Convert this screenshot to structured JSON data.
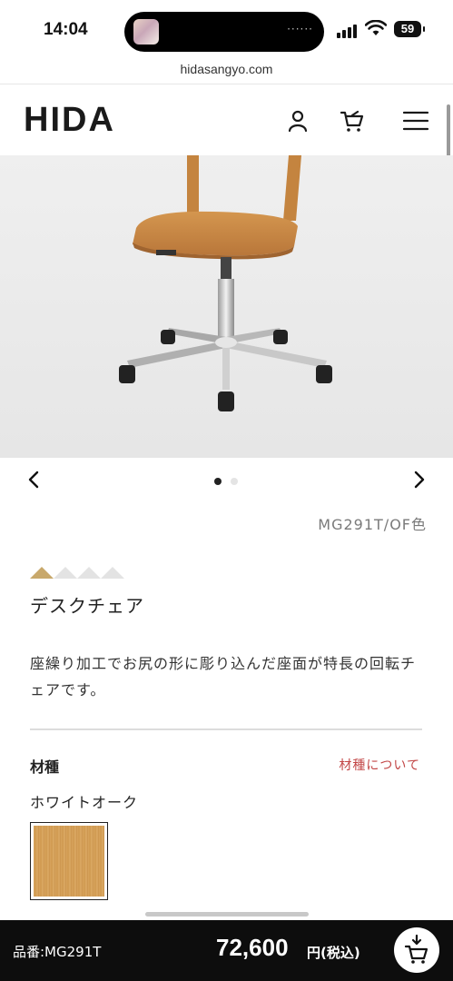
{
  "status_bar": {
    "time": "14:04",
    "island_dots": "······",
    "battery": "59"
  },
  "url_bar": {
    "url": "hidasangyo.com"
  },
  "header": {
    "logo": "HIDA",
    "icons": [
      "account-icon",
      "cart-icon",
      "menu-icon"
    ]
  },
  "carousel": {
    "total_slides": 2,
    "active_index": 0
  },
  "product": {
    "code": "MG291T/OF色",
    "rating_active": 1,
    "rating_total": 4,
    "name": "デスクチェア",
    "description": "座繰り加工でお尻の形に彫り込んだ座面が特長の回転チェアです。"
  },
  "material": {
    "label": "材種",
    "link": "材種について",
    "name": "ホワイトオーク"
  },
  "bottom_bar": {
    "code": "品番:MG291T",
    "price": "72,600",
    "price_unit": "円(税込)"
  },
  "colors": {
    "accent_gold": "#c8a86b",
    "link_red": "#c24545",
    "bottom_bar": "#0d0d0d"
  }
}
